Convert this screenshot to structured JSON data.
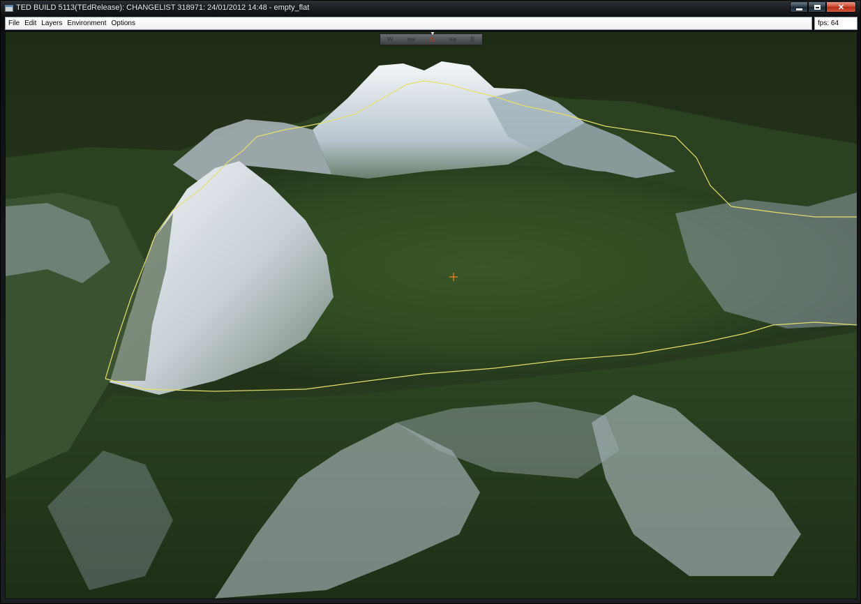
{
  "window": {
    "title": "TED BUILD 5113(TEdRelease): CHANGELIST 318971: 24/01/2012 14:48 - empty_flat",
    "close_glyph": "✕"
  },
  "menu": {
    "items": [
      "File",
      "Edit",
      "Layers",
      "Environment",
      "Options"
    ]
  },
  "status": {
    "fps_label": "fps:",
    "fps_value": "64"
  },
  "compass": {
    "ticks": [
      "W",
      "nw",
      "N",
      "ne",
      "E"
    ]
  },
  "colors": {
    "terrain_green": "#36502a",
    "snow": "#e6ebef",
    "boundary_line": "#e4df6a",
    "crosshair": "#f08a1c",
    "north": "#d32a14"
  },
  "icons": {
    "app": "app-window-icon",
    "minimize": "minimize-icon",
    "maximize": "maximize-icon",
    "close": "close-icon",
    "cursor": "crosshair-icon"
  }
}
